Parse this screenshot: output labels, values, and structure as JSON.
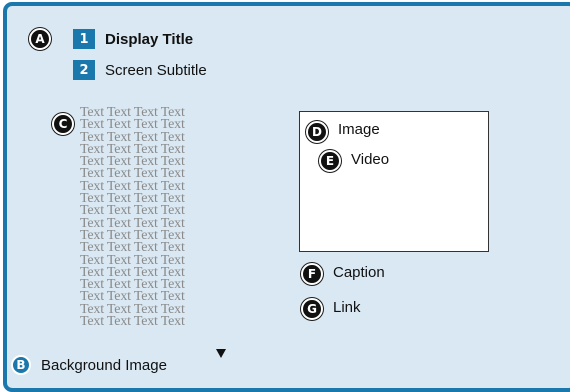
{
  "markers": {
    "a": "A",
    "b": "B",
    "c": "C",
    "d": "D",
    "e": "E",
    "f": "F",
    "g": "G",
    "n1": "1",
    "n2": "2"
  },
  "labels": {
    "display_title": "Display Title",
    "screen_subtitle": "Screen Subtitle",
    "image": "Image",
    "video": "Video",
    "caption": "Caption",
    "link": "Link",
    "background_image": "Background Image"
  },
  "placeholder_text": {
    "word": "Text",
    "columns": 4,
    "rows": 18
  },
  "icons": {
    "dropdown": "triangle-down-icon"
  },
  "colors": {
    "panel_border": "#1b78ad",
    "panel_background": "#d9e8f2",
    "number_badge": "#1b78ad",
    "placeholder_text": "#8a8a8a"
  }
}
